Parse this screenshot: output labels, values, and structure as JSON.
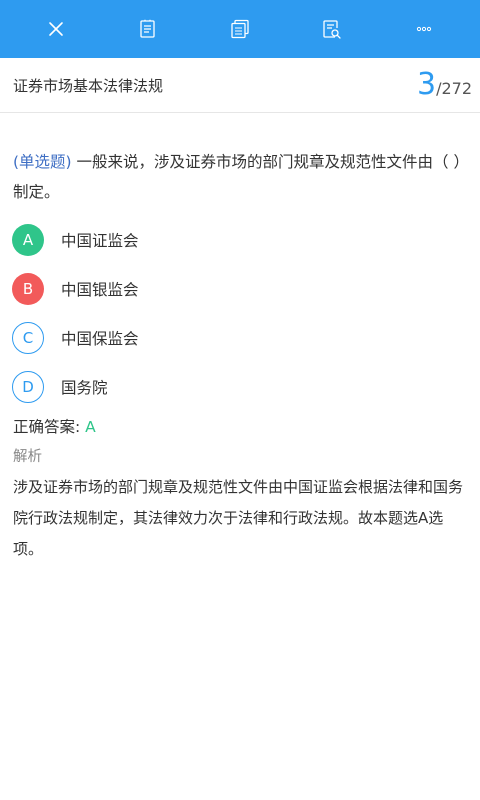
{
  "colors": {
    "toolbar_bg": "#2e9bf0",
    "accent": "#2e9bf0",
    "correct": "#2fc58a",
    "wrong": "#f25a5a",
    "question_type": "#3f6fc4"
  },
  "toolbar": {
    "icons": [
      "close-icon",
      "edit-notes-icon",
      "copy-pages-icon",
      "search-document-icon",
      "more-icon"
    ]
  },
  "header": {
    "subject": "证券市场基本法律法规",
    "current": "3",
    "separator": "/",
    "total": "272"
  },
  "question": {
    "type": "(单选题)",
    "text": " 一般来说，涉及证券市场的部门规章及规范性文件由（ ）制定。"
  },
  "options": [
    {
      "letter": "A",
      "text": "中国证监会",
      "state": "correct"
    },
    {
      "letter": "B",
      "text": "中国银监会",
      "state": "wrong"
    },
    {
      "letter": "C",
      "text": "中国保监会",
      "state": "plain"
    },
    {
      "letter": "D",
      "text": "国务院",
      "state": "plain"
    }
  ],
  "answer": {
    "label": "正确答案: ",
    "value": "A"
  },
  "analysis": {
    "title": "解析",
    "text": "涉及证券市场的部门规章及规范性文件由中国证监会根据法律和国务院行政法规制定，其法律效力次于法律和行政法规。故本题选A选项。"
  }
}
